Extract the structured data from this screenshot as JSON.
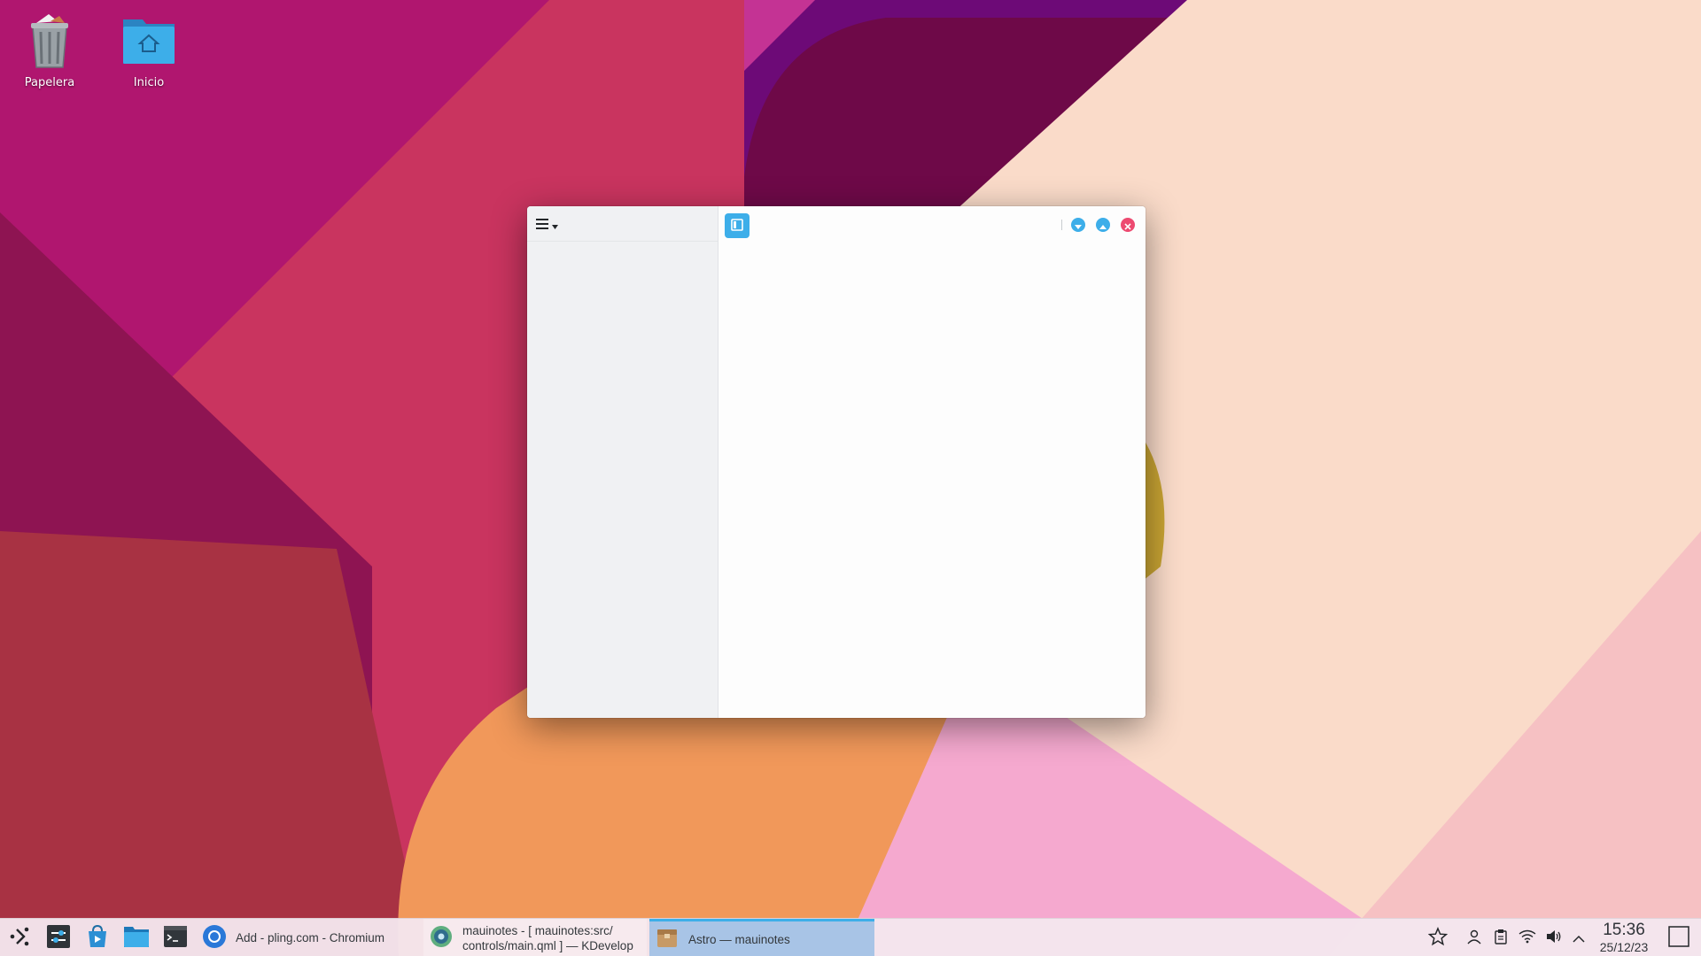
{
  "desktop": {
    "icons": [
      {
        "label": "Papelera",
        "icon": "trash-icon"
      },
      {
        "label": "Inicio",
        "icon": "home-folder-icon"
      }
    ]
  },
  "window": {
    "app": "mauinotes",
    "sidebar": {
      "menu_icon": "hamburger-menu-icon"
    },
    "controls": [
      "minimize-icon",
      "maximize-icon",
      "close-icon"
    ],
    "colors": {
      "accent": "#3daee9",
      "close": "#ed4a70",
      "minimize": "#3daee9"
    }
  },
  "taskbar": {
    "launchers": [
      "application-launcher-icon",
      "system-settings-icon",
      "discover-icon",
      "file-manager-icon",
      "terminal-icon"
    ],
    "tasks": [
      {
        "label": "Add - pling.com - Chromium",
        "icon": "chromium-icon"
      },
      {
        "label": "mauinotes - [ mauinotes:src/\ncontrols/main.qml ] — KDevelop",
        "icon": "kdevelop-icon"
      },
      {
        "label": "Astro — mauinotes",
        "icon": "package-icon",
        "active": true
      }
    ],
    "tray": [
      "favorites-icon",
      "user-icon",
      "clipboard-icon",
      "wifi-icon",
      "volume-icon",
      "expand-tray-icon"
    ],
    "clock": {
      "time": "15:36",
      "date": "25/12/23"
    }
  }
}
